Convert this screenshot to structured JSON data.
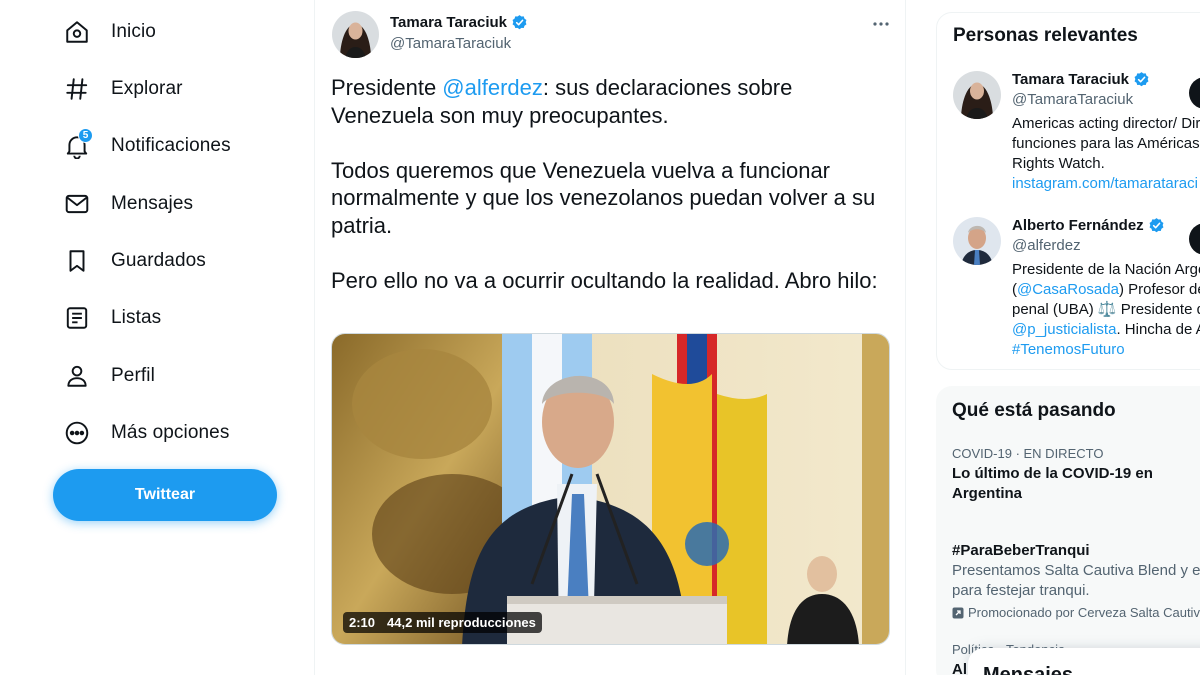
{
  "nav": {
    "items": [
      {
        "label": "Inicio",
        "icon": "home-icon"
      },
      {
        "label": "Explorar",
        "icon": "hashtag-icon"
      },
      {
        "label": "Notificaciones",
        "icon": "bell-icon",
        "badge": "5"
      },
      {
        "label": "Mensajes",
        "icon": "envelope-icon"
      },
      {
        "label": "Guardados",
        "icon": "bookmark-icon"
      },
      {
        "label": "Listas",
        "icon": "list-icon"
      },
      {
        "label": "Perfil",
        "icon": "person-icon"
      },
      {
        "label": "Más opciones",
        "icon": "more-circle-icon"
      }
    ],
    "tweet_button": "Twittear"
  },
  "tweet": {
    "author_name": "Tamara Taraciuk",
    "author_handle": "@TamaraTaraciuk",
    "text_before_mention": "Presidente ",
    "mention": "@alferdez",
    "text_after_mention": ": sus declaraciones sobre Venezuela son muy preocupantes.\n\nTodos queremos que Venezuela vuelva a funcionar normalmente y que los venezolanos puedan volver a su patria.\n\nPero ello no va a ocurrir ocultando la realidad. Abro hilo:",
    "video_duration": "2:10",
    "video_views": "44,2 mil reproducciones"
  },
  "relevant_people": {
    "title": "Personas relevantes",
    "people": [
      {
        "name": "Tamara Taraciuk",
        "handle": "@TamaraTaraciuk",
        "bio_lines": [
          "Americas acting director/ Dir",
          "funciones para las Américas",
          "Rights Watch."
        ],
        "bio_link": "instagram.com/tamarataraci"
      },
      {
        "name": "Alberto Fernández",
        "handle": "@alferdez",
        "bio_line1": "Presidente de la Nación Arge",
        "bio_line2_prefix": "(",
        "bio_line2_link": "@CasaRosada",
        "bio_line2_suffix": ") Profesor de",
        "bio_line3": "penal (UBA) ⚖️ Presidente d",
        "bio_line4_link": "@p_justicialista",
        "bio_line4_suffix": ". Hincha de A",
        "bio_line5_link": "#TenemosFuturo"
      }
    ]
  },
  "trends": {
    "title": "Qué está pasando",
    "items": [
      {
        "category": "COVID-19 · EN DIRECTO",
        "title": "Lo último de la COVID-19 en Argentina"
      },
      {
        "title": "#ParaBeberTranqui",
        "description_lines": [
          "Presentamos Salta Cautiva Blend y es",
          "para festejar tranqui."
        ],
        "promoted": "Promocionado por Cerveza Salta Cautiva"
      },
      {
        "category": "Política · Tendencia",
        "title": "Al"
      }
    ]
  },
  "messages_drawer": {
    "title": "Mensajes"
  },
  "colors": {
    "accent": "#1d9bf0",
    "text": "#0f1419",
    "secondary": "#536471"
  }
}
